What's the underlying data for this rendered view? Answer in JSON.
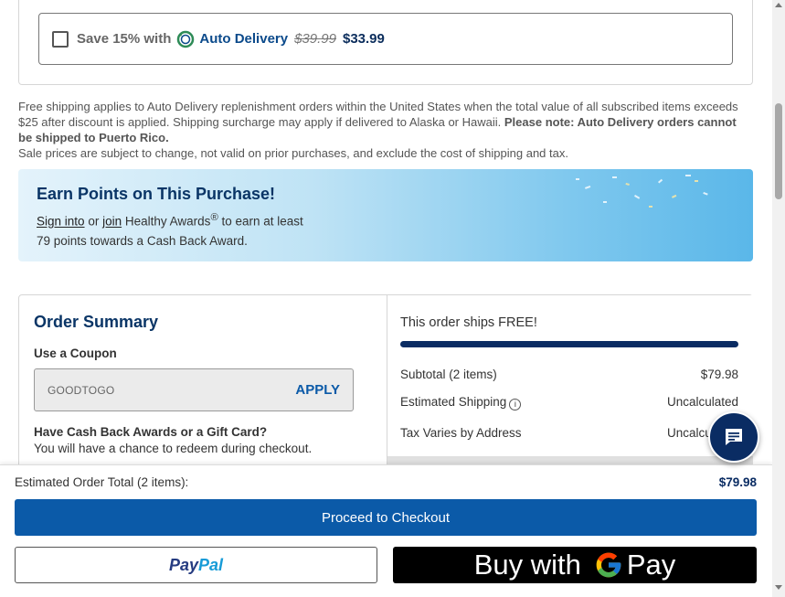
{
  "auto_delivery": {
    "save_text": "Save 15% with",
    "label": "Auto Delivery",
    "old_price": "$39.99",
    "new_price": "$33.99",
    "checked": false
  },
  "shipping_note": {
    "line1": "Free shipping applies to Auto Delivery replenishment orders within the United States when the total value of all subscribed items exceeds $25 after discount is applied. Shipping surcharge may apply if delivered to Alaska or Hawaii.",
    "bold": "Please note: Auto Delivery orders cannot be shipped to Puerto Rico.",
    "line2": "Sale prices are subject to change, not valid on prior purchases, and exclude the cost of shipping and tax."
  },
  "points": {
    "title": "Earn Points on This Purchase!",
    "sign_in": "Sign into",
    "or": "or",
    "join": "join",
    "program": "Healthy Awards",
    "reg": "®",
    "suffix": "to earn at least",
    "line2": "79 points towards a Cash Back Award."
  },
  "order_summary": {
    "title": "Order Summary",
    "coupon_label": "Use a Coupon",
    "coupon_value": "GOODTOGO",
    "apply_label": "APPLY",
    "cash_title": "Have Cash Back Awards or a Gift Card?",
    "cash_sub": "You will have a chance to redeem during checkout.",
    "ships_free": "This order ships FREE!",
    "free_shipping_progress": 1.0,
    "subtotal_label": "Subtotal (2 items)",
    "subtotal_value": "$79.98",
    "shipping_label": "Estimated Shipping",
    "shipping_value": "Uncalculated",
    "tax_label": "Tax Varies by Address",
    "tax_value": "Uncalculated"
  },
  "footer": {
    "est_label": "Estimated Order Total (2 items):",
    "est_value": "$79.98",
    "checkout_label": "Proceed to Checkout",
    "paypal_part1": "Pay",
    "paypal_part2": "Pal",
    "gpay_prefix": "Buy with",
    "gpay_suffix": "Pay"
  },
  "icons": {
    "auto_delivery": "auto-delivery-icon",
    "info": "info-icon",
    "chat": "chat-icon",
    "google": "google-g-icon"
  },
  "colors": {
    "brand_navy": "#0a2c63",
    "brand_blue": "#0b5aa8",
    "paypal_dark": "#253b80",
    "paypal_light": "#179bd7"
  }
}
